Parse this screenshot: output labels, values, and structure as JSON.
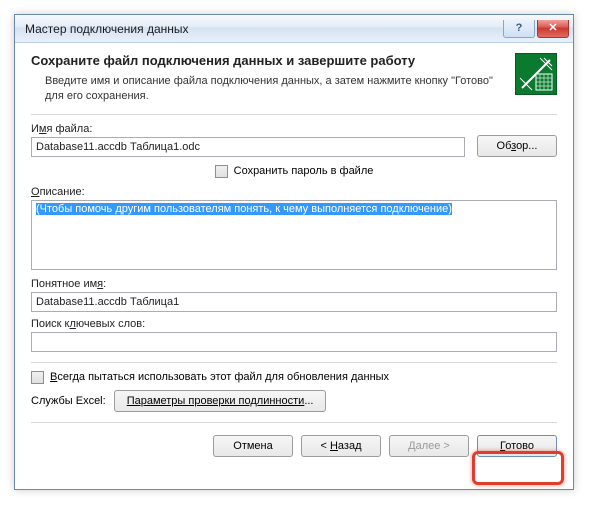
{
  "titlebar": {
    "title": "Мастер подключения данных"
  },
  "header": {
    "title": "Сохраните файл подключения данных и завершите работу",
    "desc": "Введите имя и описание файла подключения данных, а затем нажмите кнопку \"Готово\" для его сохранения."
  },
  "filename": {
    "label_pre": "И",
    "label_u": "м",
    "label_post": "я файла:",
    "value": "Database11.accdb Таблица1.odc",
    "browse_pre": "Об",
    "browse_u": "з",
    "browse_post": "ор..."
  },
  "save_pwd": {
    "label": "Сохранить пароль в файле"
  },
  "description": {
    "label_u": "О",
    "label_post": "писание:",
    "value": "(Чтобы помочь другим пользователям понять, к чему выполняется подключение)"
  },
  "friendly": {
    "label_pre": "Понятное им",
    "label_u": "я",
    "label_post": ":",
    "value": "Database11.accdb Таблица1"
  },
  "keywords": {
    "label_pre": "Поиск к",
    "label_u": "л",
    "label_post": "ючевых слов:",
    "value": ""
  },
  "always_use": {
    "label_u": "В",
    "label_post": "сегда пытаться использовать этот файл для обновления данных"
  },
  "excel": {
    "label": "Службы Excel:",
    "auth_pre": "Параметры проверки подлинности",
    "auth_post": "..."
  },
  "footer": {
    "cancel": "Отмена",
    "back_pre": "< ",
    "back_u": "Н",
    "back_post": "азад",
    "next_pre": "Да",
    "next_u": "л",
    "next_post": "ее >",
    "finish_u": "Г",
    "finish_post": "отово"
  }
}
